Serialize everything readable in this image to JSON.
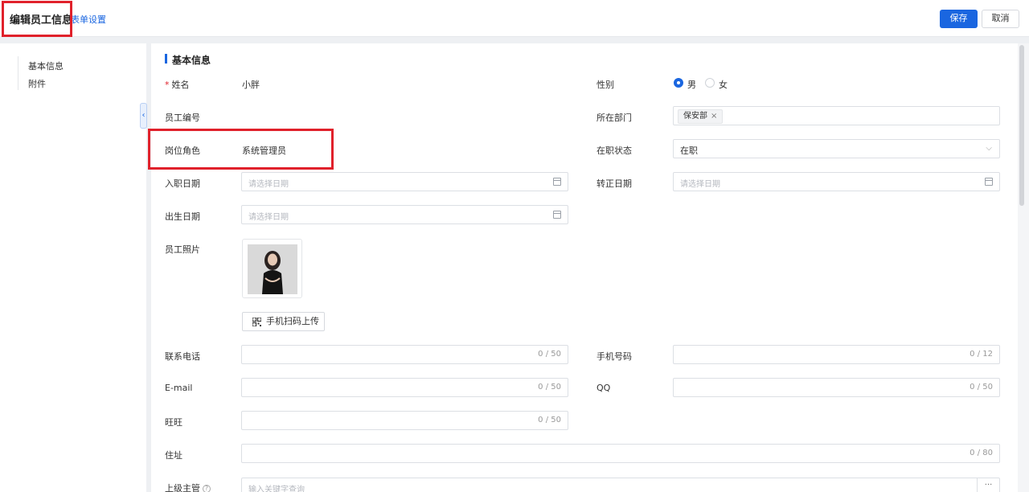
{
  "header": {
    "title": "编辑员工信息",
    "form_settings_label": "表单设置",
    "save_label": "保存",
    "cancel_label": "取消"
  },
  "sidebar": {
    "items": [
      {
        "label": "基本信息"
      },
      {
        "label": "附件"
      }
    ],
    "collapse_icon": "chevron-left-icon"
  },
  "section": {
    "title": "基本信息"
  },
  "form": {
    "name": {
      "label": "姓名",
      "required_mark": "*",
      "value": "小胖"
    },
    "gender": {
      "label": "性别",
      "options": [
        "男",
        "女"
      ],
      "selected": "男"
    },
    "employee_no": {
      "label": "员工编号"
    },
    "department": {
      "label": "所在部门",
      "tags": [
        "保安部"
      ]
    },
    "role": {
      "label": "岗位角色",
      "value": "系统管理员"
    },
    "employment_status": {
      "label": "在职状态",
      "value": "在职"
    },
    "hire_date": {
      "label": "入职日期",
      "placeholder": "请选择日期"
    },
    "regular_date": {
      "label": "转正日期",
      "placeholder": "请选择日期"
    },
    "birth_date": {
      "label": "出生日期",
      "placeholder": "请选择日期"
    },
    "photo": {
      "label": "员工照片",
      "scan_upload_label": "手机扫码上传"
    },
    "phone": {
      "label": "联系电话",
      "counter": "0 / 50"
    },
    "mobile": {
      "label": "手机号码",
      "counter": "0 / 12"
    },
    "email": {
      "label": "E-mail",
      "counter": "0 / 50"
    },
    "qq": {
      "label": "QQ",
      "counter": "0 / 50"
    },
    "wangwang": {
      "label": "旺旺",
      "counter": "0 / 50"
    },
    "address": {
      "label": "住址",
      "counter": "0 / 80"
    },
    "supervisor": {
      "label": "上级主管",
      "placeholder": "输入关键字查询"
    }
  },
  "colors": {
    "accent": "#1a66e0",
    "highlight": "#e0212b",
    "required": "#e0212b"
  }
}
